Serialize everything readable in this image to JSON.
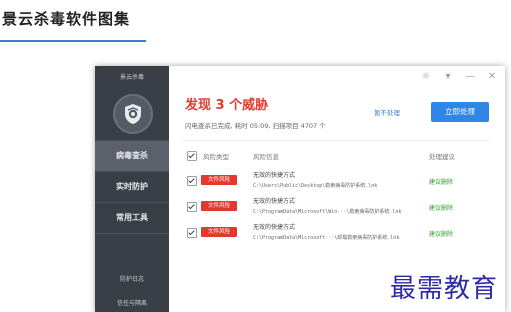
{
  "page": {
    "title": "景云杀毒软件图集"
  },
  "window": {
    "app_name": "景云杀毒",
    "controls": [
      {
        "name": "settings",
        "glyph": "☼"
      },
      {
        "name": "dropdown",
        "glyph": "▾"
      },
      {
        "name": "minimize",
        "glyph": "—"
      },
      {
        "name": "close",
        "glyph": "✕"
      }
    ]
  },
  "sidebar": {
    "items": [
      {
        "label": "病毒查杀",
        "active": true
      },
      {
        "label": "实时防护",
        "active": false
      },
      {
        "label": "常用工具",
        "active": false
      }
    ],
    "footer": [
      "防护日志",
      "信任与隔离"
    ]
  },
  "main": {
    "title": "发现 3 个威胁",
    "summary": "闪电查杀已完成, 耗时 05:09, 扫描项目 4707 个",
    "ignore_label": "暂不处理",
    "handle_label": "立即处理",
    "headers": [
      "风险类型",
      "风险信息",
      "处理建议"
    ],
    "rows": [
      {
        "badge": "文件风险",
        "name": "无效的快捷方式",
        "path": "C:\\Users\\Public\\Desktop\\勒索病毒防护系统.lnk",
        "suggest": "建议删除"
      },
      {
        "badge": "文件风险",
        "name": "无效的快捷方式",
        "path": "C:\\ProgramData\\Microsoft\\Win···\\勒索病毒防护系统.lnk",
        "suggest": "建议删除"
      },
      {
        "badge": "文件风险",
        "name": "无效的快捷方式",
        "path": "C:\\ProgramData\\Microsoft···\\卸载勒索病毒防护系统.lnk",
        "suggest": "建议删除"
      }
    ]
  },
  "watermark": "最需教育",
  "colors": {
    "accent": "#2f86e6",
    "danger": "#e03a2f",
    "success": "#33a12f",
    "sidebar": "#3a3f47"
  },
  "icons": {
    "logo": "shield-icon",
    "settings": "gear-icon"
  }
}
